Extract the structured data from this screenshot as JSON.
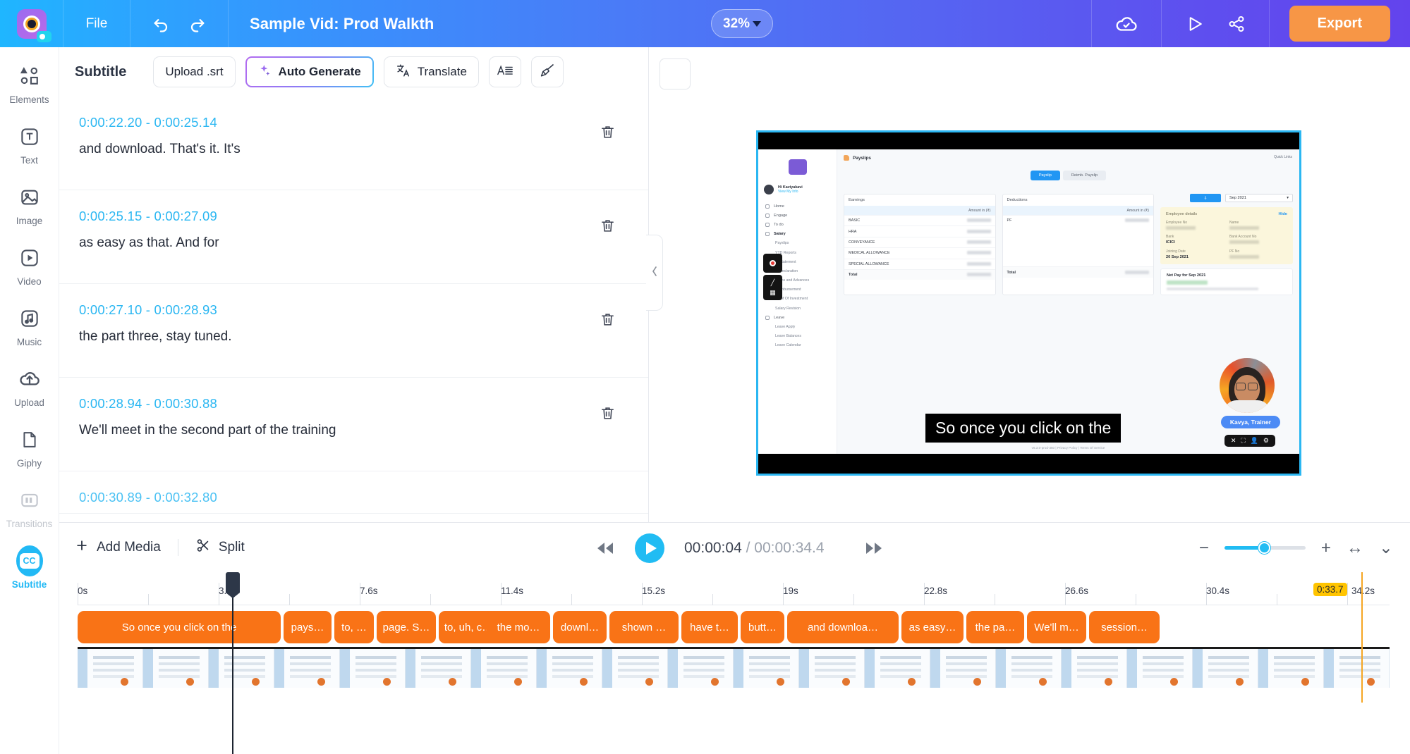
{
  "topbar": {
    "logo_name": "app-logo",
    "file_menu": "File",
    "undo_icon": "undo-icon",
    "redo_icon": "redo-icon",
    "project_title": "Sample Vid: Prod Walkth",
    "zoom_level": "32%",
    "cloud_icon": "cloud-saved-icon",
    "preview_icon": "preview-play-icon",
    "share_icon": "share-icon",
    "export_label": "Export"
  },
  "rail": {
    "items": [
      {
        "label": "Elements",
        "icon": "shapes-icon",
        "active": false
      },
      {
        "label": "Text",
        "icon": "text-icon",
        "active": false
      },
      {
        "label": "Image",
        "icon": "image-icon",
        "active": false
      },
      {
        "label": "Video",
        "icon": "video-icon",
        "active": false
      },
      {
        "label": "Music",
        "icon": "music-icon",
        "active": false
      },
      {
        "label": "Upload",
        "icon": "upload-icon",
        "active": false
      },
      {
        "label": "Giphy",
        "icon": "giphy-icon",
        "active": false
      },
      {
        "label": "Transitions",
        "icon": "transitions-icon",
        "active": false
      },
      {
        "label": "Subtitle",
        "icon": "cc-icon",
        "active": true
      }
    ]
  },
  "panel": {
    "title": "Subtitle",
    "upload_srt": "Upload .srt",
    "auto_generate": "Auto Generate",
    "translate": "Translate",
    "style_icon": "text-style-icon",
    "brush_icon": "brush-icon",
    "sparkle_icon": "sparkle-icon",
    "translate_icon": "translate-icon",
    "delete_icon": "trash-icon",
    "collapse_icon": "chevron-left-icon",
    "rows": [
      {
        "start": "0:00:22.20",
        "end": "0:00:25.14",
        "text": "and download. That's it. It's"
      },
      {
        "start": "0:00:25.15",
        "end": "0:00:27.09",
        "text": "as easy as that. And for"
      },
      {
        "start": "0:00:27.10",
        "end": "0:00:28.93",
        "text": "the part three, stay tuned."
      },
      {
        "start": "0:00:28.94",
        "end": "0:00:30.88",
        "text": "We'll meet in the second part of the training"
      },
      {
        "start": "0:00:30.89",
        "end": "0:00:32.80",
        "text": ""
      }
    ],
    "separator": "-"
  },
  "preview": {
    "caption_text": "So once you click on the",
    "app": {
      "breadcrumb": "Payslips",
      "quick_links": "Quick Links",
      "greeting": "Hi Kaviyakavi",
      "view_my_info": "View My Info",
      "nav": [
        "Home",
        "Engage",
        "To do",
        "Salary"
      ],
      "salary_sub": [
        "Payslips",
        "YTD Reports",
        "IT Statement",
        "IT Declaration",
        "Loans and Advances",
        "Reimbursement",
        "Proof Of Investment",
        "Salary Revision"
      ],
      "leave_label": "Leave",
      "leave_sub": [
        "Leave Apply",
        "Leave Balances",
        "Leave Calendar"
      ],
      "tabs": [
        "Payslip",
        "Reimb. Payslip"
      ],
      "earnings_title": "Earnings",
      "deductions_title": "Deductions",
      "amount_header": "Amount in (₹)",
      "earnings_rows": [
        "BASIC",
        "HRA",
        "CONVEYANCE",
        "MEDICAL ALLOWANCE",
        "SPECIAL ALLOWANCE"
      ],
      "earnings_total": "Total",
      "deductions_rows": [
        "PF"
      ],
      "deductions_total": "Total",
      "month_select": "Sep 2021",
      "download_icon": "download-icon",
      "employee_details_title": "Employee details",
      "hide_label": "Hide",
      "employee_fields": [
        {
          "key": "Employee No",
          "value": ""
        },
        {
          "key": "Name",
          "value": ""
        },
        {
          "key": "Bank",
          "value": "ICICI"
        },
        {
          "key": "Bank Account No",
          "value": ""
        },
        {
          "key": "Joining Date",
          "value": "20 Sep 2021"
        },
        {
          "key": "PF No",
          "value": ""
        }
      ],
      "net_pay_title": "Net Pay for Sep 2021",
      "footer": "v6.3.0-prod-350  |  Privacy Policy  |  Terms Of Service"
    },
    "webcam": {
      "name_badge": "Kavya, Trainer",
      "controls": [
        "close-icon",
        "crop-icon",
        "person-icon",
        "settings-icon"
      ]
    }
  },
  "bottombar": {
    "add_media": "Add Media",
    "add_media_icon": "plus-icon",
    "split": "Split",
    "split_icon": "scissors-icon",
    "rewind_icon": "rewind-icon",
    "play_icon": "play-icon",
    "forward_icon": "fast-forward-icon",
    "current_time": "00:00:04",
    "time_separator": "/",
    "total_time": "00:00:34.4",
    "zoom_out_icon": "minus-icon",
    "zoom_in_icon": "plus-icon",
    "fit_icon": "fit-width-icon",
    "collapse_icon": "chevron-down-icon"
  },
  "timeline": {
    "ticks": [
      "0s",
      "3.8s",
      "7.6s",
      "11.4s",
      "15.2s",
      "19s",
      "22.8s",
      "26.6s",
      "30.4s",
      "34.2s"
    ],
    "playhead_badge": "0:33.7",
    "clips": [
      "So once you click on the",
      "pays…",
      "to, …",
      "page. S…",
      "to, uh, c…",
      "the mo…",
      "downl…",
      "shown …",
      "have t…",
      "butt…",
      "and downloa…",
      "as easy…",
      "the pa…",
      "We'll m…",
      "session…"
    ]
  }
}
